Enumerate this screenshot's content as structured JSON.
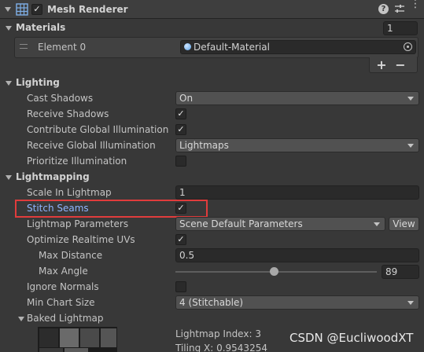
{
  "header": {
    "component_title": "Mesh Renderer",
    "enabled": true,
    "icons": [
      "grid-icon",
      "help-icon",
      "settings-sliders-icon",
      "more-icon"
    ]
  },
  "materials": {
    "title": "Materials",
    "count": "1",
    "element_label": "Element 0",
    "element_value": "Default-Material",
    "add_label": "+",
    "remove_label": "−"
  },
  "lighting": {
    "title": "Lighting",
    "cast_shadows_label": "Cast Shadows",
    "cast_shadows_value": "On",
    "receive_shadows_label": "Receive Shadows",
    "receive_shadows": true,
    "contribute_gi_label": "Contribute Global Illumination",
    "contribute_gi": true,
    "receive_gi_label": "Receive Global Illumination",
    "receive_gi_value": "Lightmaps",
    "prioritize_label": "Prioritize Illumination",
    "prioritize": false
  },
  "lightmapping": {
    "title": "Lightmapping",
    "scale_label": "Scale In Lightmap",
    "scale_value": "1",
    "stitch_label": "Stitch Seams",
    "stitch": true,
    "params_label": "Lightmap Parameters",
    "params_value": "Scene Default Parameters",
    "view_label": "View",
    "optimize_label": "Optimize Realtime UVs",
    "optimize": true,
    "max_distance_label": "Max Distance",
    "max_distance_value": "0.5",
    "max_angle_label": "Max Angle",
    "max_angle_value": "89",
    "max_angle_fraction": 0.49,
    "ignore_normals_label": "Ignore Normals",
    "ignore_normals": false,
    "min_chart_label": "Min Chart Size",
    "min_chart_value": "4 (Stitchable)"
  },
  "baked": {
    "title": "Baked Lightmap",
    "index_text": "Lightmap Index: 3",
    "tiling_text": "Tiling X: 0.9543254"
  },
  "watermark": "CSDN @EucliwoodXT",
  "colors": {
    "background": "#383838",
    "highlight": "#e03c3c",
    "stitch_label": "#8fb5ff",
    "material_icon": "#5aa0e6"
  }
}
